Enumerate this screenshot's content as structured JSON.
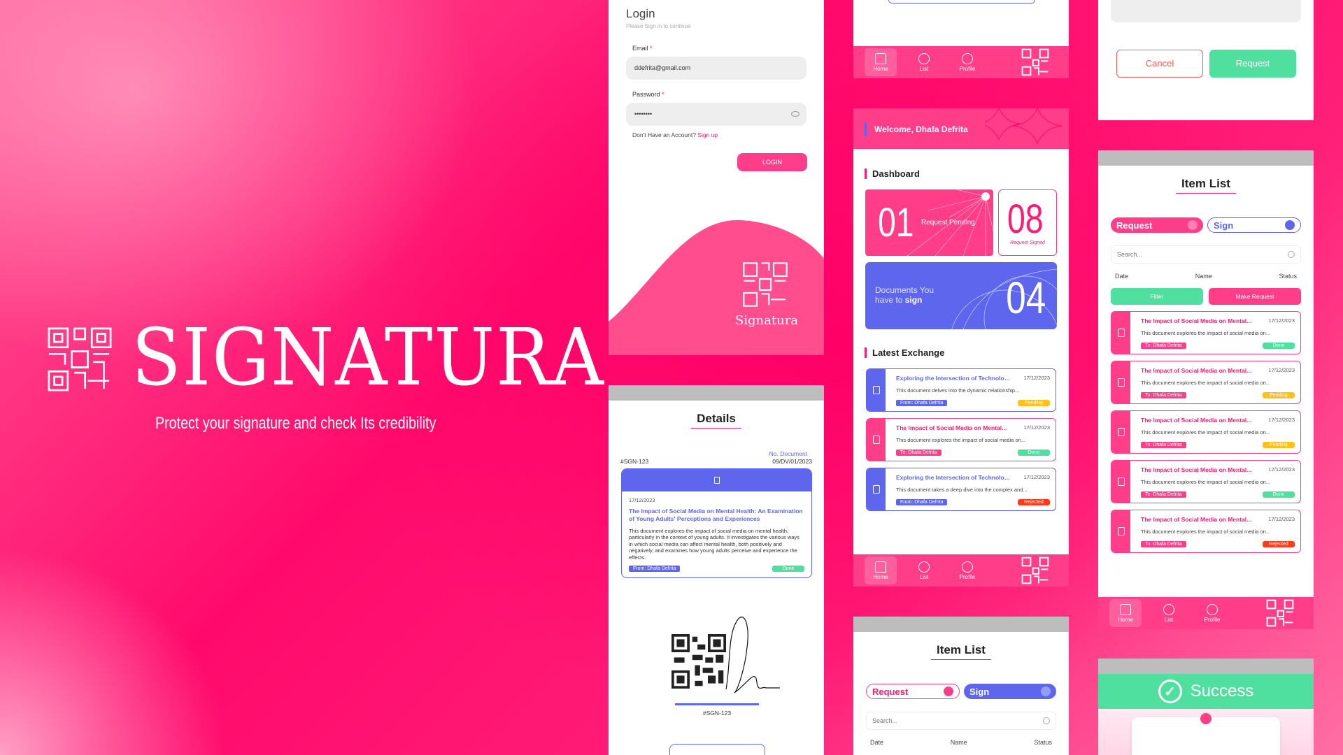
{
  "brand": {
    "name": "SIGNATURA",
    "tagline": "Protect your signature and check Its credibility"
  },
  "login": {
    "title": "Login",
    "subtitle": "Please Sign in to continue",
    "email_label": "Email",
    "email_value": "ddefrita@gmail.com",
    "password_label": "Password",
    "password_value": "••••••••",
    "no_account": "Don't Have an Account?",
    "signup": "Sign up",
    "button": "LOGIN",
    "logo_text": "Signatura"
  },
  "nav": {
    "home": "Home",
    "list": "List",
    "profile": "Profile"
  },
  "dashboard": {
    "welcome": "Welcome, Dhafa Defrita",
    "section": "Dashboard",
    "pending_count": "01",
    "pending_label": "Request Pending",
    "signed_count": "08",
    "signed_label": "Request Signed",
    "docs_count": "04",
    "docs_label_1": "Documents You",
    "docs_label_2": "have to",
    "docs_label_bold": "sign",
    "latest": "Latest Exchange",
    "items": [
      {
        "title": "Exploring the Intersection of Technology...",
        "date": "17/12/2023",
        "text": "This document delves into the dynamic relationship...",
        "tag": "From: Dhafa Defrita",
        "status": "Pending"
      },
      {
        "title": "The Impact of Social Media on Mental...",
        "date": "17/12/2023",
        "text": "This document explores the impact of social media on...",
        "tag": "To: Dhafa Defrita",
        "status": "Done"
      },
      {
        "title": "Exploring the Intersection of Technology...",
        "date": "17/12/2023",
        "text": "This document takes a deep dive into the complex and...",
        "tag": "From: Dhafa Defrita",
        "status": "Rejected"
      }
    ]
  },
  "details": {
    "title": "Details",
    "id": "#SGN-123",
    "no_label": "No. Document",
    "no_value": "09/DV/01/2023",
    "date": "17/12/2023",
    "doc_title": "The Impact of Social Media on Mental Health: An Examination of Young Adults' Perceptions and Experiences",
    "doc_text": "This document explores the impact of social media on mental health, particularly in the context of young adults. It investigates the various ways in which social media can affect mental health, both positively and negatively, and examines how young adults perceive and experience the effects.",
    "from": "From: Dhafa Defrita",
    "status": "Done",
    "qr_id": "#SGN-123"
  },
  "modal": {
    "cancel": "Cancel",
    "request": "Request"
  },
  "itemlist": {
    "title": "Item List",
    "tab_request": "Request",
    "tab_sign": "Sign",
    "search": "Search...",
    "sort_date": "Date",
    "sort_name": "Name",
    "sort_status": "Status",
    "filter": "Filter",
    "make_request": "Make Request",
    "items": [
      {
        "title": "The Impact of Social Media on Mental...",
        "date": "17/12/2023",
        "text": "This document explores the impact of social media on...",
        "tag": "To: Dhafa Defrita",
        "status": "Done"
      },
      {
        "title": "The Impact of Social Media on Mental...",
        "date": "17/12/2023",
        "text": "This document explores the impact of social media on...",
        "tag": "To: Dhafa Defrita",
        "status": "Pending"
      },
      {
        "title": "The Impact of Social Media on Mental...",
        "date": "17/12/2023",
        "text": "This document explores the impact of social media on...",
        "tag": "To: Dhafa Defrita",
        "status": "Pending"
      },
      {
        "title": "The Impact of Social Media on Mental...",
        "date": "17/12/2023",
        "text": "This document explores the impact of social media on...",
        "tag": "To: Dhafa Defrita",
        "status": "Done"
      },
      {
        "title": "The Impact of Social Media on Mental...",
        "date": "17/12/2023",
        "text": "This document explores the impact of social media on...",
        "tag": "To: Dhafa Defrita",
        "status": "Rejected"
      }
    ]
  },
  "success": {
    "title": "Success"
  },
  "colors": {
    "pink": "#ff1a72",
    "blue": "#5f66ee",
    "green": "#4fe0a0",
    "yellow": "#ffc017",
    "red": "#ff3a1a"
  }
}
